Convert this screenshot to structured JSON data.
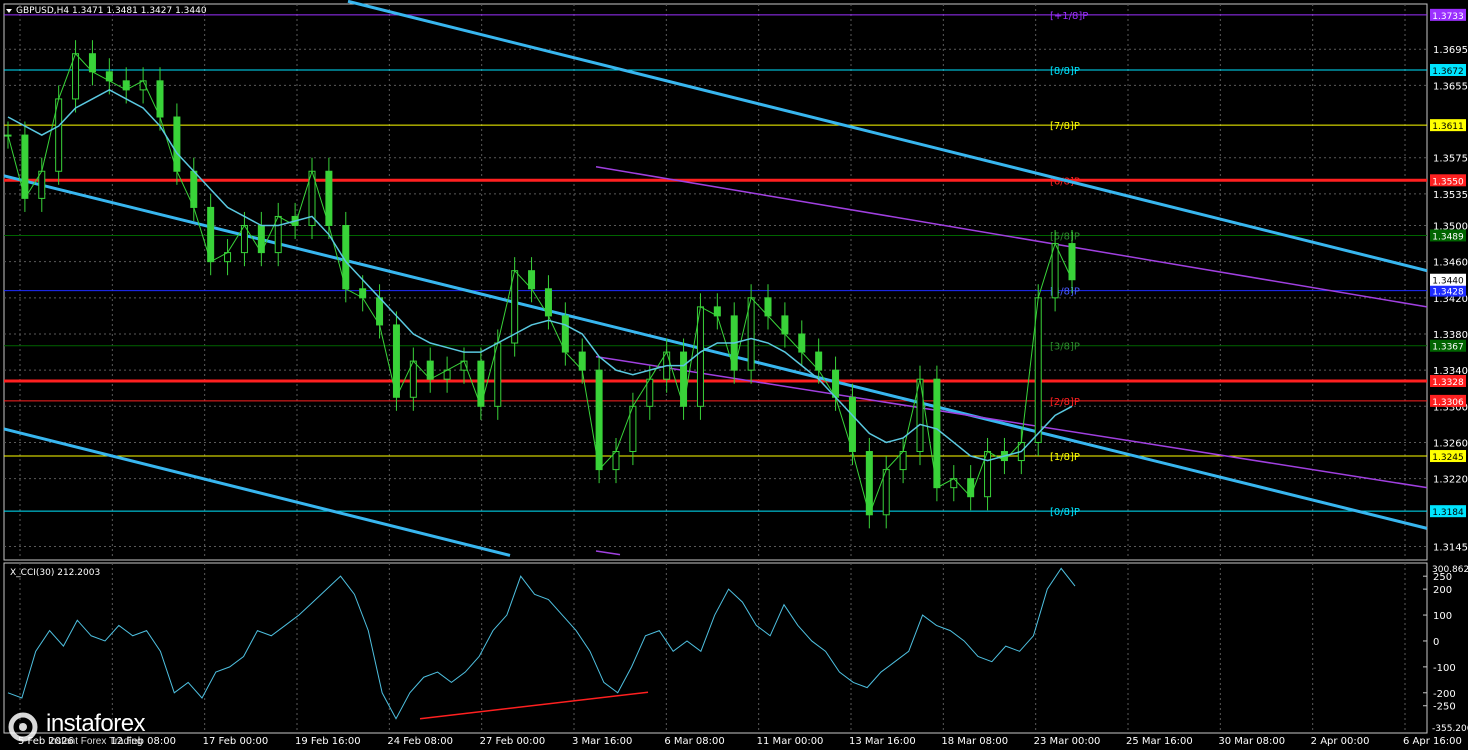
{
  "header": {
    "symbol_info": "GBPUSD,H4  1.3471  1.3481  1.3427  1.3440"
  },
  "indicator": {
    "label": "X_CCI(30) 212.2003"
  },
  "watermark": {
    "brand": "instaforex",
    "tagline": "Instant Forex Trading"
  },
  "chart_data": [
    {
      "type": "candlestick",
      "title": "GBPUSD,H4",
      "ylim": [
        1.313,
        1.3745
      ],
      "y_ticks": [
        1.3695,
        1.3655,
        1.3575,
        1.3535,
        1.35,
        1.346,
        1.342,
        1.338,
        1.334,
        1.33,
        1.326,
        1.322,
        1.3145
      ],
      "x_ticks": [
        "5 Feb 2026",
        "12 Feb 08:00",
        "17 Feb 00:00",
        "19 Feb 16:00",
        "24 Feb 08:00",
        "27 Feb 00:00",
        "3 Mar 16:00",
        "6 Mar 08:00",
        "11 Mar 00:00",
        "13 Mar 16:00",
        "18 Mar 08:00",
        "23 Mar 00:00",
        "25 Mar 16:00",
        "30 Mar 08:00",
        "2 Apr 00:00",
        "6 Apr 16:00"
      ],
      "price_series": [
        1.36,
        1.353,
        1.356,
        1.364,
        1.369,
        1.367,
        1.366,
        1.365,
        1.366,
        1.362,
        1.356,
        1.352,
        1.346,
        1.347,
        1.35,
        1.347,
        1.351,
        1.35,
        1.356,
        1.35,
        1.343,
        1.342,
        1.339,
        1.331,
        1.335,
        1.333,
        1.334,
        1.335,
        1.33,
        1.337,
        1.345,
        1.343,
        1.34,
        1.336,
        1.334,
        1.323,
        1.325,
        1.33,
        1.333,
        1.336,
        1.33,
        1.341,
        1.34,
        1.334,
        1.342,
        1.34,
        1.338,
        1.336,
        1.334,
        1.331,
        1.325,
        1.318,
        1.323,
        1.325,
        1.333,
        1.321,
        1.322,
        1.32,
        1.325,
        1.324,
        1.326,
        1.342,
        1.348,
        1.344
      ],
      "moving_average": [
        1.362,
        1.361,
        1.36,
        1.361,
        1.363,
        1.364,
        1.365,
        1.364,
        1.363,
        1.361,
        1.358,
        1.356,
        1.354,
        1.352,
        1.351,
        1.35,
        1.35,
        1.3505,
        1.351,
        1.349,
        1.346,
        1.344,
        1.342,
        1.34,
        1.338,
        1.337,
        1.3365,
        1.336,
        1.336,
        1.337,
        1.338,
        1.339,
        1.3395,
        1.339,
        1.338,
        1.3355,
        1.334,
        1.3335,
        1.334,
        1.3345,
        1.3345,
        1.336,
        1.337,
        1.337,
        1.3375,
        1.337,
        1.336,
        1.3345,
        1.333,
        1.331,
        1.329,
        1.327,
        1.326,
        1.3265,
        1.328,
        1.3275,
        1.326,
        1.3245,
        1.324,
        1.3245,
        1.325,
        1.327,
        1.329,
        1.33
      ],
      "horizontal_levels": [
        {
          "label": "[+1/8]P",
          "value": 1.3733,
          "tag": "1.3733",
          "color": "#9b30ff",
          "thick": false
        },
        {
          "label": "[8/8]P",
          "value": 1.3672,
          "tag": "1.3672",
          "color": "#00e5ff",
          "thick": false
        },
        {
          "label": "[7/8]P",
          "value": 1.3611,
          "tag": "1.3611",
          "color": "#ffff00",
          "thick": false
        },
        {
          "label": "[6/8]P",
          "value": 1.355,
          "tag": "1.3550",
          "color": "#ff2020",
          "thick": true
        },
        {
          "label": "[5/8]P",
          "value": 1.3489,
          "tag": "1.3489",
          "color": "#006400",
          "thick": false
        },
        {
          "label": "[4/8]P",
          "value": 1.3428,
          "tag": "1.3428",
          "color": "#1e2cff",
          "thick": false
        },
        {
          "label": "[3/8]P",
          "value": 1.3367,
          "tag": "1.3367",
          "color": "#006400",
          "thick": false
        },
        {
          "label": "",
          "value": 1.3328,
          "tag": "1.3328",
          "color": "#ff2020",
          "thick": true
        },
        {
          "label": "[2/8]P",
          "value": 1.3306,
          "tag": "1.3306",
          "color": "#ff2020",
          "thick": false
        },
        {
          "label": "[1/8]P",
          "value": 1.3245,
          "tag": "1.3245",
          "color": "#ffff00",
          "thick": false
        },
        {
          "label": "[0/8]P",
          "value": 1.3184,
          "tag": "1.3184",
          "color": "#00e5ff",
          "thick": false
        }
      ],
      "current_price": {
        "value": 1.344,
        "tag": "1.3440"
      }
    },
    {
      "type": "line",
      "title": "X_CCI(30) 212.2003",
      "ylim": [
        -355.206,
        300.8623
      ],
      "y_ticks": [
        250,
        200,
        100,
        0,
        -100,
        -200,
        -250
      ],
      "range_tags": [
        "300.8623",
        "-355.206"
      ],
      "values": [
        -200,
        -220,
        -40,
        40,
        -20,
        80,
        20,
        0,
        60,
        20,
        40,
        -40,
        -200,
        -160,
        -220,
        -120,
        -100,
        -60,
        40,
        20,
        60,
        100,
        150,
        200,
        250,
        180,
        40,
        -200,
        -300,
        -200,
        -140,
        -120,
        -160,
        -120,
        -60,
        40,
        100,
        250,
        180,
        160,
        100,
        40,
        -40,
        -160,
        -200,
        -100,
        20,
        40,
        -40,
        0,
        -40,
        100,
        200,
        150,
        60,
        20,
        140,
        60,
        0,
        -40,
        -120,
        -160,
        -180,
        -120,
        -80,
        -40,
        100,
        60,
        40,
        0,
        -60,
        -80,
        -20,
        -40,
        20,
        200,
        280,
        212
      ]
    }
  ]
}
